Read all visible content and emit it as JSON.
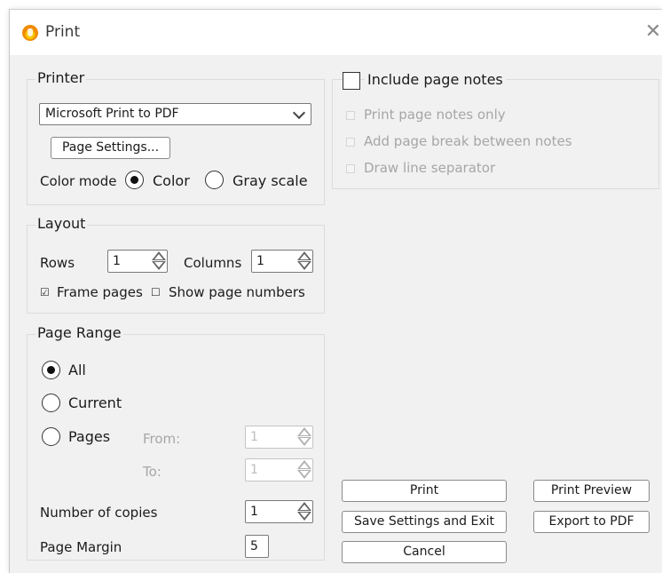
{
  "window": {
    "title": "Print"
  },
  "printer": {
    "group_title": "Printer",
    "selected_printer": "Microsoft Print to PDF",
    "page_settings_label": "Page Settings...",
    "color_mode_label": "Color mode",
    "color_option": "Color",
    "gray_option": "Gray scale",
    "color_selected": "Color"
  },
  "layout": {
    "group_title": "Layout",
    "rows_label": "Rows",
    "rows_value": "1",
    "columns_label": "Columns",
    "columns_value": "1",
    "frame_pages_label": "Frame pages",
    "frame_pages_checked": true,
    "show_page_numbers_label": "Show page numbers",
    "show_page_numbers_checked": false
  },
  "page_range": {
    "group_title": "Page Range",
    "all_label": "All",
    "current_label": "Current",
    "pages_label": "Pages",
    "selected": "All",
    "from_label": "From:",
    "from_value": "1",
    "to_label": "To:",
    "to_value": "1",
    "copies_label": "Number of copies",
    "copies_value": "1",
    "margin_label": "Page Margin",
    "margin_value": "5"
  },
  "notes": {
    "include_label": "Include page notes",
    "include_checked": false,
    "notes_only_label": "Print page notes only",
    "page_break_label": "Add page break between notes",
    "separator_label": "Draw line separator"
  },
  "buttons": {
    "print": "Print",
    "print_preview": "Print Preview",
    "save_exit": "Save Settings and Exit",
    "export_pdf": "Export to PDF",
    "cancel": "Cancel"
  },
  "icons": {
    "app": "app-flame-icon",
    "close": "close-icon",
    "dropdown": "chevron-down-icon"
  },
  "glyphs": {
    "close": "✕"
  }
}
